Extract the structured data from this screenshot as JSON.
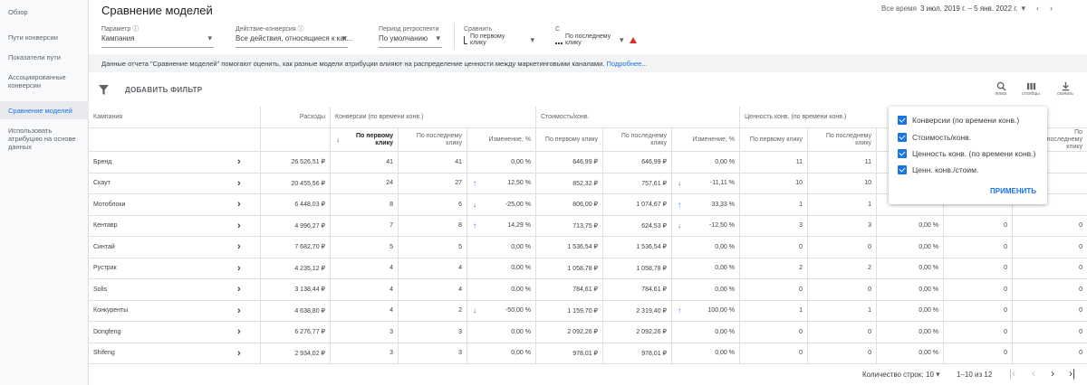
{
  "sidebar": {
    "items": [
      {
        "label": "Обзор",
        "active": false
      },
      {
        "label": "Пути конверсии",
        "active": false
      },
      {
        "label": "Показатели пути",
        "active": false
      },
      {
        "label": "Ассоциированные конверсии",
        "active": false
      },
      {
        "label": "Сравнение моделей",
        "active": true
      },
      {
        "label": "Использовать атрибуцию на основе данных",
        "active": false
      }
    ]
  },
  "header": {
    "title": "Сравнение моделей",
    "date_prefix": "Все время",
    "date_value": "3 июл. 2019 г. – 5 янв. 2022 г."
  },
  "controls": {
    "param": {
      "label": "Параметр",
      "value": "Кампания"
    },
    "action": {
      "label": "Действие-конверсия",
      "value": "Все действия, относящиеся к кат..."
    },
    "period": {
      "label": "Период ретроспекти",
      "value": "По умолчанию"
    },
    "compare": {
      "label": "Сравнить",
      "value": "По первому клику"
    },
    "with": {
      "label": "С",
      "value": "По последнему клику"
    }
  },
  "info": {
    "text": "Данные отчета \"Сравнение моделей\" помогают оценить, как разные модели атрибуции влияют на распределение ценности между маркетинговыми каналами.",
    "more": "Подробнее..."
  },
  "filter": {
    "add_label": "ДОБАВИТЬ ФИЛЬТР",
    "search": "поиск",
    "columns": "столбцы",
    "download": "скачать"
  },
  "table": {
    "col_campaign": "Кампания",
    "col_spend": "Расходы",
    "grp_conv": "Конверсии (по времени конв.)",
    "grp_cost": "Стоимость/конв.",
    "grp_value": "Ценность конв. (по времени конв.)",
    "sub_first": "По первому клику",
    "sub_last": "По последнему клику",
    "sub_change": "Изменение, %",
    "rows": [
      {
        "name": "Бренд",
        "spend": "26 526,51 ₽",
        "c1": "41",
        "c2": "41",
        "cc": "0,00 %",
        "cd": "",
        "p1": "646,99 ₽",
        "p2": "646,99 ₽",
        "pc": "0,00 %",
        "pd": "",
        "v1": "11",
        "v2": "11",
        "vc": "",
        "vr": ""
      },
      {
        "name": "Скаут",
        "spend": "20 455,56 ₽",
        "c1": "24",
        "c2": "27",
        "cc": "12,50 %",
        "cd": "up",
        "p1": "852,32 ₽",
        "p2": "757,61 ₽",
        "pc": "-11,11 %",
        "pd": "down",
        "v1": "10",
        "v2": "10",
        "vc": "",
        "vr": ""
      },
      {
        "name": "Мотоблоки",
        "spend": "6 448,03 ₽",
        "c1": "8",
        "c2": "6",
        "cc": "-25,00 %",
        "cd": "down",
        "p1": "806,00 ₽",
        "p2": "1 074,67 ₽",
        "pc": "33,33 %",
        "pd": "up",
        "v1": "1",
        "v2": "1",
        "vc": "",
        "vr": ""
      },
      {
        "name": "Кентавр",
        "spend": "4 996,27 ₽",
        "c1": "7",
        "c2": "8",
        "cc": "14,29 %",
        "cd": "up",
        "p1": "713,75 ₽",
        "p2": "624,53 ₽",
        "pc": "-12,50 %",
        "pd": "down",
        "v1": "3",
        "v2": "3",
        "vc": "0,00 %",
        "vr": "0"
      },
      {
        "name": "Синтай",
        "spend": "7 682,70 ₽",
        "c1": "5",
        "c2": "5",
        "cc": "0,00 %",
        "cd": "",
        "p1": "1 536,54 ₽",
        "p2": "1 536,54 ₽",
        "pc": "0,00 %",
        "pd": "",
        "v1": "0",
        "v2": "0",
        "vc": "0,00 %",
        "vr": "0"
      },
      {
        "name": "Рустрак",
        "spend": "4 235,12 ₽",
        "c1": "4",
        "c2": "4",
        "cc": "0,00 %",
        "cd": "",
        "p1": "1 058,78 ₽",
        "p2": "1 058,78 ₽",
        "pc": "0,00 %",
        "pd": "",
        "v1": "2",
        "v2": "2",
        "vc": "0,00 %",
        "vr": "0"
      },
      {
        "name": "Solis",
        "spend": "3 138,44 ₽",
        "c1": "4",
        "c2": "4",
        "cc": "0,00 %",
        "cd": "",
        "p1": "784,61 ₽",
        "p2": "784,61 ₽",
        "pc": "0,00 %",
        "pd": "",
        "v1": "0",
        "v2": "0",
        "vc": "0,00 %",
        "vr": "0"
      },
      {
        "name": "Конкуренты",
        "spend": "4 638,80 ₽",
        "c1": "4",
        "c2": "2",
        "cc": "-50,00 %",
        "cd": "down",
        "p1": "1 159,70 ₽",
        "p2": "2 319,40 ₽",
        "pc": "100,00 %",
        "pd": "up",
        "v1": "1",
        "v2": "1",
        "vc": "0,00 %",
        "vr": "0"
      },
      {
        "name": "Dongfeng",
        "spend": "6 276,77 ₽",
        "c1": "3",
        "c2": "3",
        "cc": "0,00 %",
        "cd": "",
        "p1": "2 092,26 ₽",
        "p2": "2 092,26 ₽",
        "pc": "0,00 %",
        "pd": "",
        "v1": "0",
        "v2": "0",
        "vc": "0,00 %",
        "vr": "0"
      },
      {
        "name": "Shifeng",
        "spend": "2 934,02 ₽",
        "c1": "3",
        "c2": "3",
        "cc": "0,00 %",
        "cd": "",
        "p1": "978,01 ₽",
        "p2": "978,01 ₽",
        "pc": "0,00 %",
        "pd": "",
        "v1": "0",
        "v2": "0",
        "vc": "0,00 %",
        "vr": "0"
      }
    ]
  },
  "popup": {
    "options": [
      "Конверсии (по времени конв.)",
      "Стоимость/конв.",
      "Ценность конв. (по времени конв.)",
      "Ценн. конв./стоим."
    ],
    "apply": "ПРИМЕНИТЬ"
  },
  "footer": {
    "rows_label": "Количество строк:",
    "rows_value": "10",
    "range": "1–10 из 12"
  },
  "colors": {
    "accent": "#1a73e8",
    "warning": "#d93025"
  }
}
